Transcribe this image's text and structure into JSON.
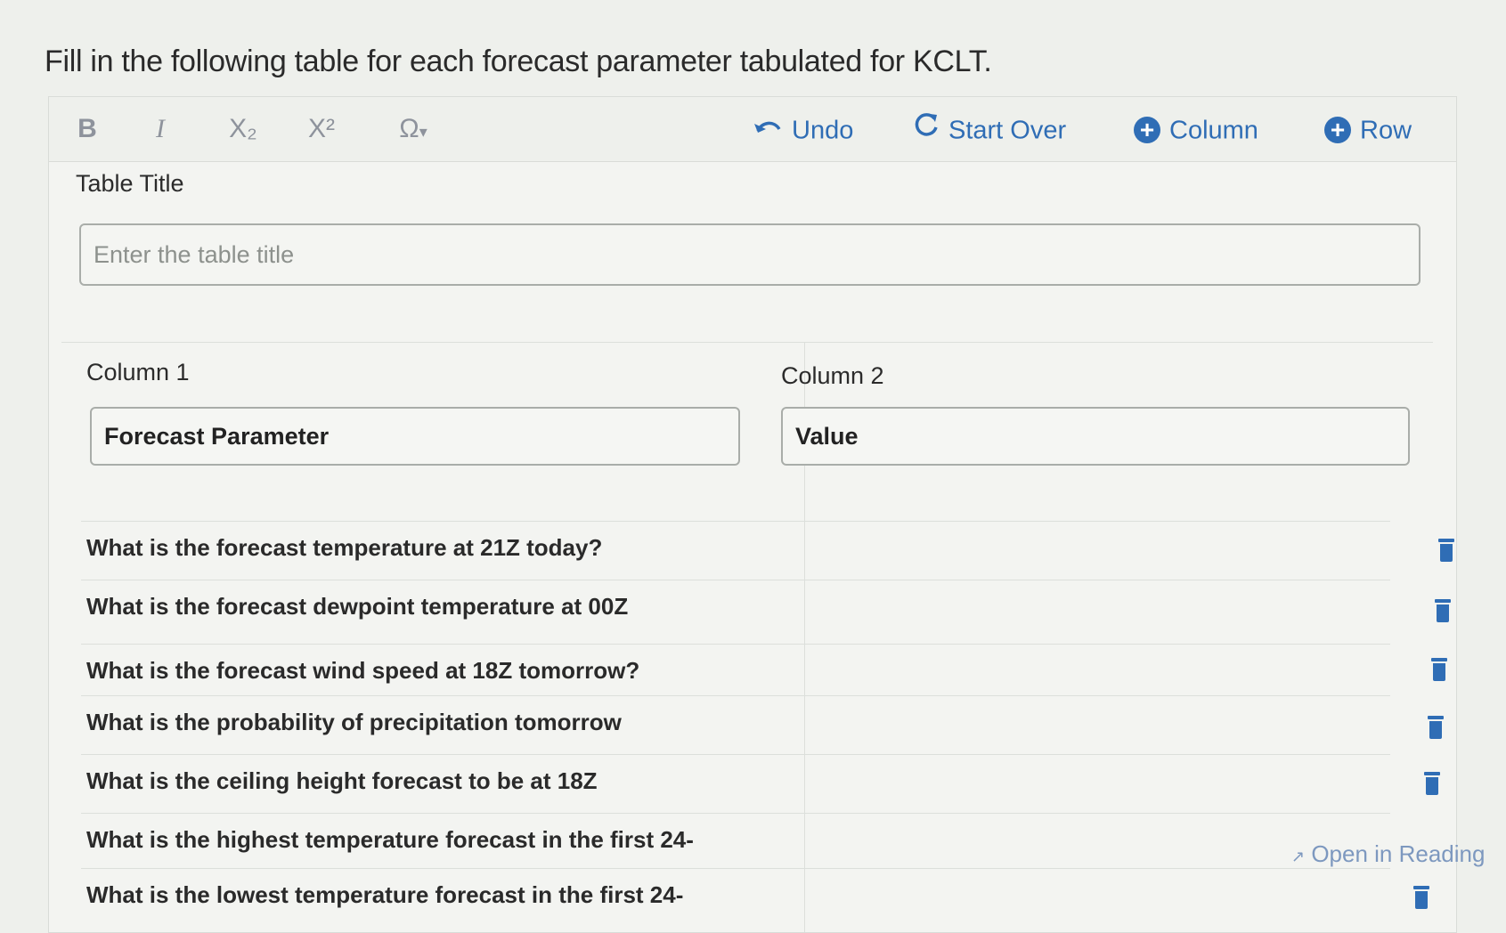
{
  "question": "Fill in the following table for each forecast parameter tabulated for KCLT.",
  "toolbar": {
    "bold": "B",
    "italic": "I",
    "subscript": "X₂",
    "superscript": "X²",
    "symbols": "Ω",
    "symbols_caret": "▾",
    "undo": "Undo",
    "start_over": "Start Over",
    "add_column": "Column",
    "add_row": "Row"
  },
  "table_title": {
    "label": "Table Title",
    "placeholder": "Enter the table title",
    "value": ""
  },
  "columns": [
    {
      "label": "Column 1",
      "value": "Forecast Parameter"
    },
    {
      "label": "Column 2",
      "value": "Value"
    }
  ],
  "rows": [
    {
      "parameter": "What is the forecast temperature at 21Z today?",
      "value": ""
    },
    {
      "parameter": "What is the forecast dewpoint temperature at 00Z",
      "value": ""
    },
    {
      "parameter": "What is the forecast wind speed at 18Z tomorrow?",
      "value": ""
    },
    {
      "parameter": "What is the probability of precipitation tomorrow",
      "value": ""
    },
    {
      "parameter": "What is the ceiling height forecast to be at 18Z",
      "value": ""
    },
    {
      "parameter": "What is the highest temperature forecast in the first 24-",
      "value": ""
    },
    {
      "parameter": "What is the lowest temperature forecast in the first 24-",
      "value": ""
    }
  ],
  "reading_link": "Open in Reading",
  "colors": {
    "accent": "#2f6db5",
    "text": "#2b2b2b",
    "muted": "#8e939c"
  }
}
